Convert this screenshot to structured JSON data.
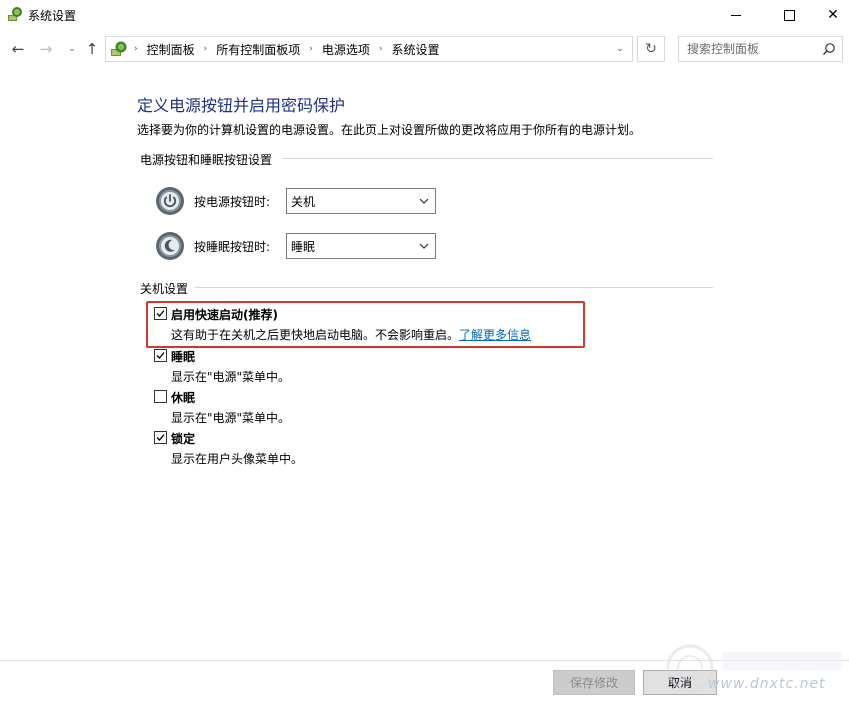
{
  "window": {
    "title": "系统设置",
    "controls": {
      "minimize": "",
      "maximize": "",
      "close": "✕"
    }
  },
  "navigation": {
    "back": "←",
    "forward": "→",
    "recent": "⌄",
    "up": "↑",
    "breadcrumbs": [
      "控制面板",
      "所有控制面板项",
      "电源选项",
      "系统设置"
    ],
    "separator": "›",
    "dropdown": "⌄",
    "refresh": "↻",
    "search_placeholder": "搜索控制面板"
  },
  "page": {
    "title": "定义电源按钮并启用密码保护",
    "description": "选择要为你的计算机设置的电源设置。在此页上对设置所做的更改将应用于你所有的电源计划。"
  },
  "buttons_section": {
    "header": "电源按钮和睡眠按钮设置",
    "power_button": {
      "label": "按电源按钮时:",
      "value": "关机"
    },
    "sleep_button": {
      "label": "按睡眠按钮时:",
      "value": "睡眠"
    }
  },
  "shutdown_section": {
    "header": "关机设置",
    "options": [
      {
        "label": "启用快速启动(推荐)",
        "checked": true,
        "description": "这有助于在关机之后更快地启动电脑。不会影响重启。",
        "link": "了解更多信息"
      },
      {
        "label": "睡眠",
        "checked": true,
        "description": "显示在\"电源\"菜单中。"
      },
      {
        "label": "休眠",
        "checked": false,
        "description": "显示在\"电源\"菜单中。"
      },
      {
        "label": "锁定",
        "checked": true,
        "description": "显示在用户头像菜单中。"
      }
    ]
  },
  "footer": {
    "save": "保存修改",
    "cancel": "取消"
  },
  "watermark": {
    "text": "www.dnxtc.net"
  },
  "colors": {
    "title_blue": "#1e3287",
    "link_blue": "#0066cc",
    "highlight_red": "#d6352b"
  }
}
